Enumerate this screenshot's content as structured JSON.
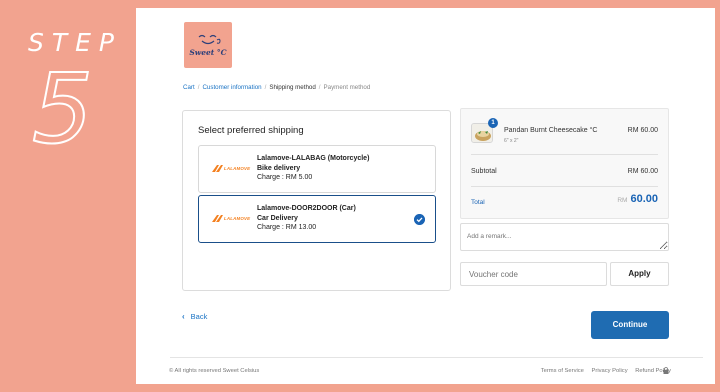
{
  "overlay": {
    "step_word": "STEP",
    "step_number": "5"
  },
  "brand": {
    "name": "Sweet °C"
  },
  "breadcrumb": {
    "cart": "Cart",
    "customer": "Customer information",
    "shipping": "Shipping method",
    "payment": "Payment method",
    "sep": "/"
  },
  "shipping": {
    "title": "Select preferred shipping",
    "options": [
      {
        "logo_text": "LALAMOVE",
        "name": "Lalamove-LALABAG (Motorcycle)",
        "type": "Bike delivery",
        "charge": "Charge : RM 5.00",
        "selected": false
      },
      {
        "logo_text": "LALAMOVE",
        "name": "Lalamove-DOOR2DOOR (Car)",
        "type": "Car Delivery",
        "charge": "Charge : RM 13.00",
        "selected": true
      }
    ]
  },
  "nav": {
    "back_label": "Back",
    "continue_label": "Continue"
  },
  "summary": {
    "item": {
      "quantity": "1",
      "name": "Pandan Burnt Cheesecake °C",
      "variant": "6\" x 2\"",
      "price": "RM 60.00"
    },
    "subtotal_label": "Subtotal",
    "subtotal_value": "RM 60.00",
    "total_label": "Total",
    "total_currency": "RM",
    "total_value": "60.00"
  },
  "remark": {
    "placeholder": "Add a remark..."
  },
  "voucher": {
    "placeholder": "Voucher code",
    "apply_label": "Apply"
  },
  "footer": {
    "copyright": "© All rights reserved Sweet Celsius",
    "links": [
      "Terms of Service",
      "Privacy Policy",
      "Refund Policy"
    ]
  },
  "colors": {
    "background": "#f2a38f",
    "accent": "#1f6cb2",
    "lalamove": "#f4801f"
  }
}
